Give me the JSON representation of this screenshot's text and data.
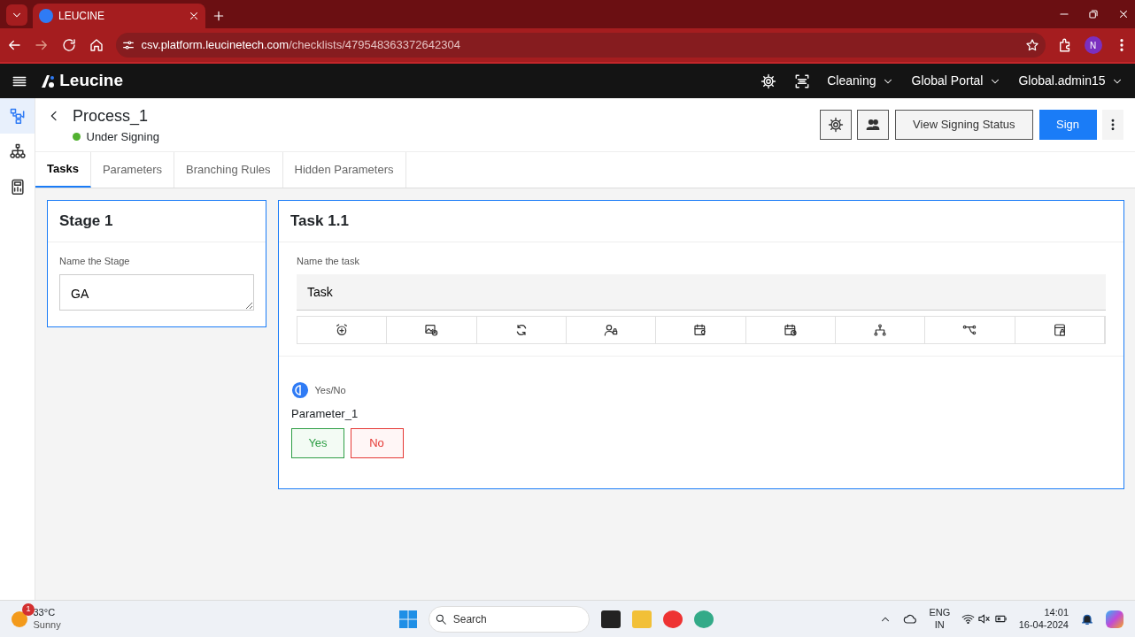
{
  "browser": {
    "tab_title": "LEUCINE",
    "url_host": "csv.platform.leucinetech.com",
    "url_path": "/checklists/479548363372642304",
    "profile_initial": "N"
  },
  "app": {
    "brand": "Leucine",
    "nav": [
      {
        "label": "Cleaning"
      },
      {
        "label": "Global Portal"
      },
      {
        "label": "Global.admin15"
      }
    ]
  },
  "sidebar": {
    "items": [
      {
        "selected": true
      },
      {
        "selected": false
      },
      {
        "selected": false
      }
    ]
  },
  "header": {
    "title": "Process_1",
    "status": "Under Signing",
    "buttons": [
      {
        "label": "View Signing Status",
        "kind": "secondary"
      },
      {
        "label": "Sign",
        "kind": "primary"
      }
    ]
  },
  "tabs": [
    {
      "label": "Tasks",
      "selected": true
    },
    {
      "label": "Parameters",
      "selected": false
    },
    {
      "label": "Branching Rules",
      "selected": false
    },
    {
      "label": "Hidden Parameters",
      "selected": false
    }
  ],
  "stage": {
    "title": "Stage 1",
    "label": "Name the Stage",
    "value": "GA"
  },
  "task": {
    "title": "Task 1.1",
    "label": "Name the task",
    "value": "Task"
  },
  "parameter": {
    "type": "Yes/No",
    "name": "Parameter_1",
    "options": [
      {
        "label": "Yes",
        "kind": "positive"
      },
      {
        "label": "No",
        "kind": "negative"
      }
    ]
  },
  "taskbar": {
    "weather_badge": "1",
    "temperature": "33°C",
    "condition": "Sunny",
    "search_placeholder": "Search",
    "language": "ENG",
    "region": "IN",
    "time": "14:01",
    "date": "16-04-2024"
  }
}
